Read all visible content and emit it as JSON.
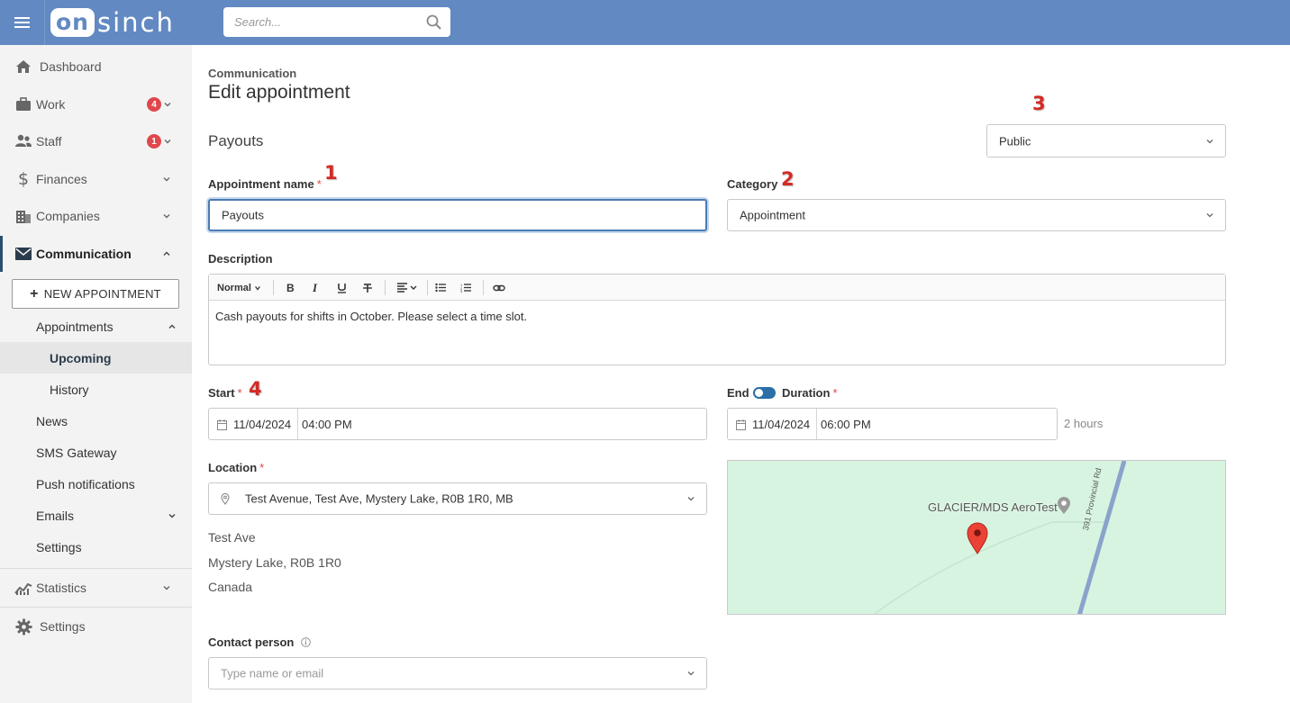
{
  "header": {
    "logo_on": "on",
    "logo_sinch": "sinch",
    "search_placeholder": "Search..."
  },
  "sidebar": {
    "items": [
      {
        "label": "Dashboard",
        "icon": "home-icon"
      },
      {
        "label": "Work",
        "icon": "briefcase-icon",
        "badge": "4"
      },
      {
        "label": "Staff",
        "icon": "users-icon",
        "badge": "1"
      },
      {
        "label": "Finances",
        "icon": "dollar-icon"
      },
      {
        "label": "Companies",
        "icon": "building-icon"
      },
      {
        "label": "Communication",
        "icon": "envelope-icon"
      }
    ],
    "new_button": "NEW APPOINTMENT",
    "sub": {
      "appointments": "Appointments",
      "upcoming": "Upcoming",
      "history": "History",
      "news": "News",
      "sms": "SMS Gateway",
      "push": "Push notifications",
      "emails": "Emails",
      "settings": "Settings"
    },
    "statistics": "Statistics",
    "settings": "Settings"
  },
  "main": {
    "breadcrumb": "Communication",
    "title": "Edit appointment",
    "section": "Payouts",
    "visibility": "Public",
    "name_label": "Appointment name",
    "name_value": "Payouts",
    "category_label": "Category",
    "category_value": "Appointment",
    "description_label": "Description",
    "editor_style": "Normal",
    "description_text": "Cash payouts for shifts in October. Please select a time slot.",
    "start_label": "Start",
    "start_date": "11/04/2024",
    "start_time": "04:00 PM",
    "end_label": "End",
    "duration_label": "Duration",
    "end_date": "11/04/2024",
    "end_time": "06:00 PM",
    "duration_hint": "2 hours",
    "location_label": "Location",
    "location_value": "Test Avenue, Test Ave, Mystery Lake, R0B 1R0, MB",
    "address": [
      "Test Ave",
      "Mystery Lake, R0B 1R0",
      "Canada"
    ],
    "map_place": "GLACIER/MDS AeroTest",
    "map_road": "391 Provincial Rd",
    "contact_label": "Contact person",
    "contact_placeholder": "Type name or email",
    "required_mark": "*"
  },
  "markers": {
    "m1": "1",
    "m2": "2",
    "m3": "3",
    "m4": "4"
  },
  "colors": {
    "header": "#6289c2",
    "accent": "#2a6fa8",
    "badge": "#e0474c",
    "marker": "#d42a24"
  }
}
